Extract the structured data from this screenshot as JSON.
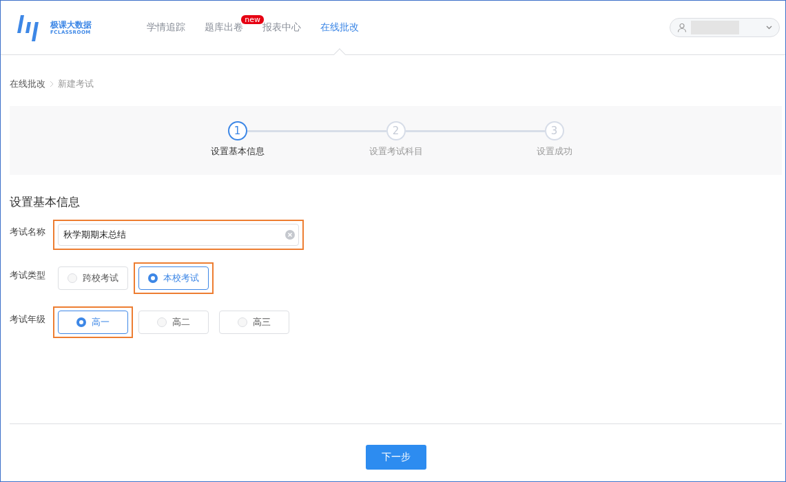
{
  "header": {
    "logo": {
      "title": "极课大数据",
      "subtitle": "FCLASSROOM"
    },
    "nav": [
      {
        "label": "学情追踪",
        "selected": false
      },
      {
        "label": "题库出卷",
        "selected": false,
        "badge": "new"
      },
      {
        "label": "报表中心",
        "selected": false
      },
      {
        "label": "在线批改",
        "selected": true
      }
    ]
  },
  "breadcrumb": [
    {
      "label": "在线批改",
      "current": false
    },
    {
      "label": "新建考试",
      "current": true
    }
  ],
  "steps": [
    {
      "number": "1",
      "label": "设置基本信息",
      "selected": true
    },
    {
      "number": "2",
      "label": "设置考试科目",
      "selected": false
    },
    {
      "number": "3",
      "label": "设置成功",
      "selected": false
    }
  ],
  "section_title": "设置基本信息",
  "form": [
    {
      "kind": "text",
      "label": "考试名称",
      "value": "秋学期期末总结",
      "highlighted": true
    },
    {
      "kind": "radio",
      "label": "考试类型",
      "options": [
        {
          "label": "跨校考试",
          "selected": false,
          "highlighted": false
        },
        {
          "label": "本校考试",
          "selected": true,
          "highlighted": true
        }
      ]
    },
    {
      "kind": "radio",
      "label": "考试年级",
      "options": [
        {
          "label": "高一",
          "selected": true,
          "highlighted": true
        },
        {
          "label": "高二",
          "selected": false,
          "highlighted": false
        },
        {
          "label": "高三",
          "selected": false,
          "highlighted": false
        }
      ]
    }
  ],
  "next_button": "下一步"
}
